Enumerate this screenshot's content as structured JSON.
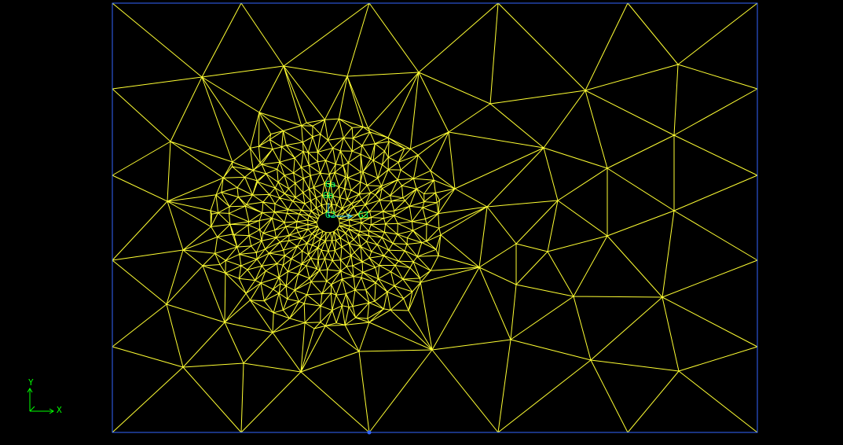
{
  "colors": {
    "background": "#000000",
    "mesh": "#ffff33",
    "boundary": "#3366ff",
    "triad": "#00ff00",
    "node_labels": "#00ff66"
  },
  "axis_triad": {
    "x_label": "X",
    "y_label": "Y"
  },
  "node_labels": [
    "Ga",
    "Gb",
    "G2",
    "G3"
  ]
}
